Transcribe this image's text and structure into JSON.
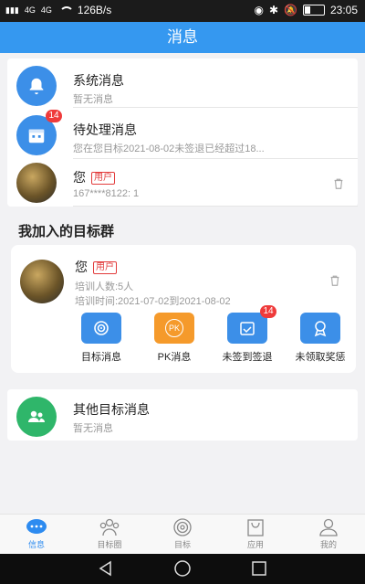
{
  "status": {
    "signal_left": "4G",
    "signal_right": "4G",
    "net_speed": "126B/s",
    "time": "23:05"
  },
  "header": {
    "title": "消息"
  },
  "messages": [
    {
      "title": "系统消息",
      "subtitle": "暂无消息"
    },
    {
      "title": "待处理消息",
      "subtitle": "您在您目标2021-08-02未签退已经超过18...",
      "badge": "14"
    },
    {
      "title": "您",
      "tag": "用户",
      "subtitle": "167****8122: 1"
    }
  ],
  "section": {
    "title": "我加入的目标群"
  },
  "group": {
    "name": "您",
    "tag": "用户",
    "members": "培训人数:5人",
    "time": "培训时间:2021-07-02到2021-08-02",
    "actions": [
      {
        "label": "目标消息"
      },
      {
        "label": "PK消息",
        "icon_text": "PK"
      },
      {
        "label": "未签到签退",
        "badge": "14"
      },
      {
        "label": "未领取奖惩"
      }
    ]
  },
  "other": {
    "title": "其他目标消息",
    "subtitle": "暂无消息"
  },
  "tabs": [
    {
      "label": "信息",
      "icon": "chat-icon"
    },
    {
      "label": "目标圈",
      "icon": "people-icon"
    },
    {
      "label": "目标",
      "icon": "target-icon"
    },
    {
      "label": "应用",
      "icon": "bag-icon"
    },
    {
      "label": "我的",
      "icon": "user-icon"
    }
  ],
  "colors": {
    "primary": "#3598f0",
    "badge": "#ef3b3b",
    "green": "#2fb66a",
    "orange": "#f59a2b"
  }
}
